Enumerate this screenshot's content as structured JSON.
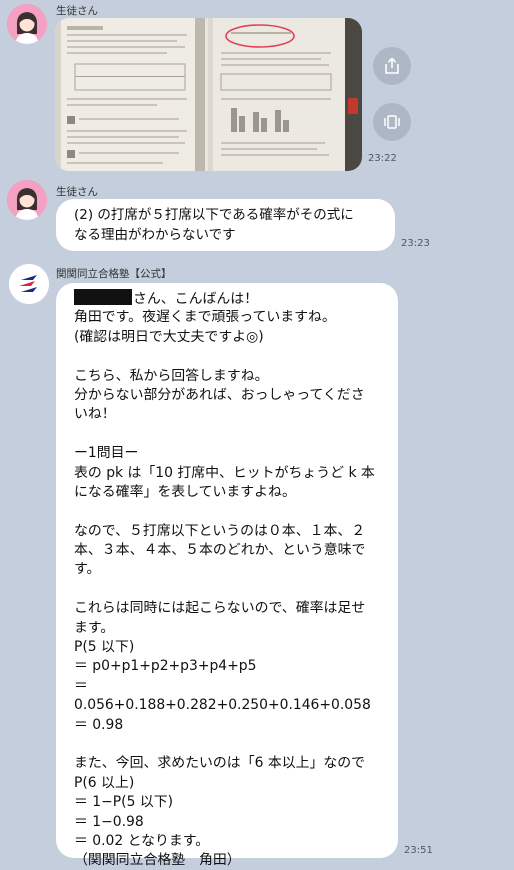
{
  "messages": [
    {
      "sender": "生徒さん",
      "time": "23:22",
      "type": "images",
      "image_count": 2,
      "actions": {
        "share": "share-icon",
        "gallery": "gallery-icon"
      }
    },
    {
      "sender": "生徒さん",
      "time": "23:23",
      "text": "(2) の打席が５打席以下である確率がその式に\nなる理由がわからないです"
    },
    {
      "sender": "関関同立合格塾【公式】",
      "time": "23:51",
      "greeting_suffix": "さん、こんばんは！",
      "lines": [
        "角田です。夜遅くまで頑張っていますね。",
        "(確認は明日で大丈夫ですよ◎)",
        "",
        "こちら、私から回答しますね。",
        "分からない部分があれば、おっしゃってくださ",
        "いね！",
        "",
        "ー1問目ー",
        "表の pk は「10 打席中、ヒットがちょうど k 本",
        "になる確率」を表していますよね。",
        "",
        "なので、５打席以下というのは０本、１本、２",
        "本、３本、４本、５本のどれか、という意味で",
        "す。",
        "",
        "これらは同時には起こらないので、確率は足せ",
        "ます。",
        "P(5 以下)",
        "＝ p0+p1+p2+p3+p4+p5",
        "＝",
        "0.056+0.188+0.282+0.250+0.146+0.058",
        "＝ 0.98",
        "",
        "また、今回、求めたいのは「6 本以上」なので",
        "P(6 以上)",
        "＝ 1−P(5 以下)",
        "＝ 1−0.98",
        "＝ 0.02 となります。",
        "（関関同立合格塾　角田）"
      ]
    }
  ],
  "colors": {
    "background": "#c4cedd",
    "bubble": "#ffffff",
    "student_avatar": "#f3a0c2",
    "brand_blue": "#1b2a8a",
    "brand_red": "#d8263a"
  }
}
